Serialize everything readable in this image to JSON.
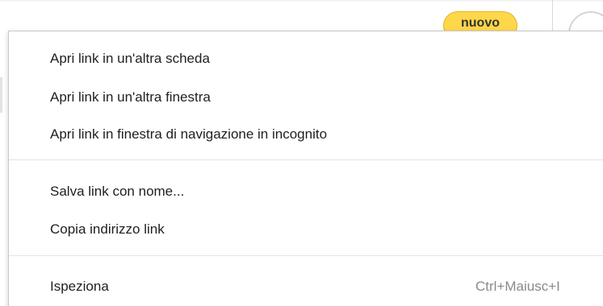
{
  "background": {
    "badge_label": "nuovo",
    "badge_color": "#ffd74a"
  },
  "context_menu": {
    "groups": [
      {
        "items": [
          {
            "label": "Apri link in un'altra scheda"
          },
          {
            "label": "Apri link in un'altra finestra"
          },
          {
            "label": "Apri link in finestra di navigazione in incognito"
          }
        ]
      },
      {
        "items": [
          {
            "label": "Salva link con nome..."
          },
          {
            "label": "Copia indirizzo link"
          }
        ]
      },
      {
        "items": [
          {
            "label": "Ispeziona",
            "shortcut": "Ctrl+Maiusc+I"
          }
        ]
      }
    ]
  }
}
